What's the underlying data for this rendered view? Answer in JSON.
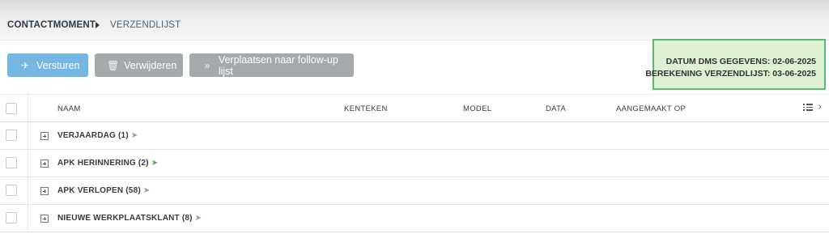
{
  "breadcrumb": {
    "level1": "CONTACTMOMENT",
    "level2": "VERZENDLIJST"
  },
  "toolbar": {
    "send_label": "Versturen",
    "delete_label": "Verwijderen",
    "move_label": "Verplaatsen naar follow-up lijst"
  },
  "info": {
    "line1": "DATUM DMS GEGEVENS: 02-06-2025",
    "line2": "BEREKENING VERZENDLIJST: 03-06-2025"
  },
  "table": {
    "columns": [
      "NAAM",
      "KENTEKEN",
      "MODEL",
      "DATA",
      "AANGEMAAKT OP"
    ],
    "groups": [
      {
        "label": "VERJAARDAG (1)",
        "status": "sent-grey"
      },
      {
        "label": "APK HERINNERING (2)",
        "status": "sent-green"
      },
      {
        "label": "APK VERLOPEN (58)",
        "status": "sent-grey"
      },
      {
        "label": "NIEUWE WERKPLAATSKLANT (8)",
        "status": "sent-grey"
      }
    ]
  },
  "colors": {
    "accent_blue": "#74b7e3",
    "disabled_grey": "#a4a9ae",
    "info_bg": "#ddf0d2",
    "info_border": "#5ab879",
    "sent_green": "#3fae5a"
  }
}
